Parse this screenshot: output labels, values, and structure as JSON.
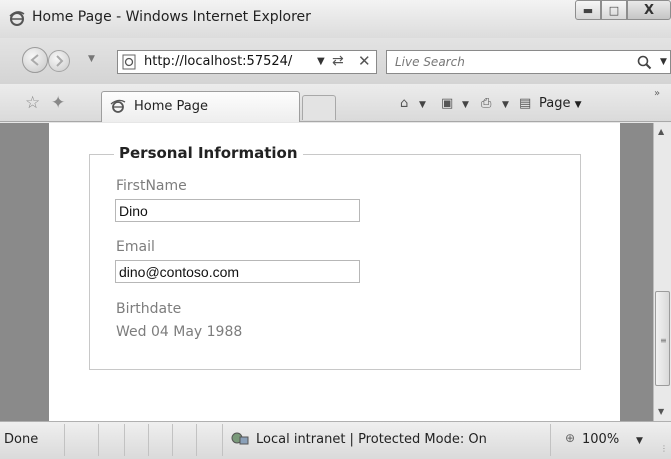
{
  "window": {
    "title": "Home Page - Windows Internet Explorer"
  },
  "address_bar": {
    "url": "http://localhost:57524/"
  },
  "search": {
    "placeholder": "Live Search"
  },
  "tab": {
    "label": "Home Page"
  },
  "command_bar": {
    "page_label": "Page"
  },
  "form": {
    "legend": "Personal Information",
    "first_name_label": "FirstName",
    "first_name_value": "Dino",
    "email_label": "Email",
    "email_value": "dino@contoso.com",
    "birthdate_label": "Birthdate",
    "birthdate_value": "Wed 04 May 1988"
  },
  "status_bar": {
    "status": "Done",
    "zone": "Local intranet | Protected Mode: On",
    "zoom": "100%"
  }
}
